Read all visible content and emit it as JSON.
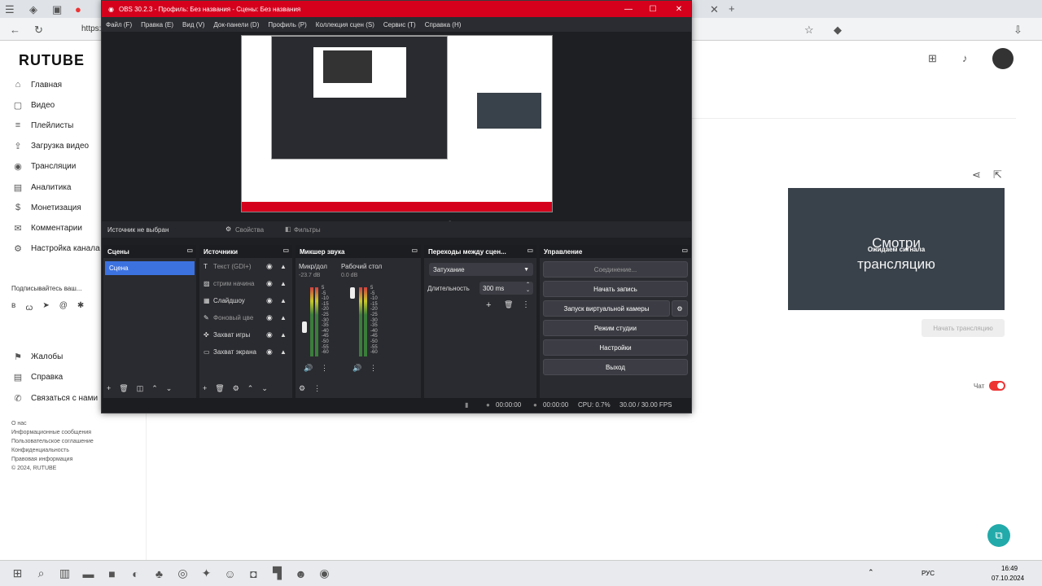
{
  "browser": {
    "tab_url": "https://",
    "icons": [
      "menu-icon",
      "shield-icon",
      "tabs-icon",
      "yandex-icon",
      "back-icon",
      "reload-icon",
      "new-tab-icon",
      "close-tab-icon",
      "star-icon",
      "extensions-icon",
      "profile-icon",
      "downloads-icon"
    ]
  },
  "site": {
    "logo": "RUTUBE",
    "nav": [
      {
        "label": "Главная",
        "icon": "home-icon"
      },
      {
        "label": "Видео",
        "icon": "video-icon"
      },
      {
        "label": "Плейлисты",
        "icon": "playlist-icon"
      },
      {
        "label": "Загрузка видео",
        "icon": "upload-icon"
      },
      {
        "label": "Трансляции",
        "icon": "broadcast-icon"
      },
      {
        "label": "Аналитика",
        "icon": "analytics-icon"
      },
      {
        "label": "Монетизация",
        "icon": "money-icon"
      },
      {
        "label": "Комментарии",
        "icon": "comments-icon"
      },
      {
        "label": "Настройка канала",
        "icon": "settings-icon"
      }
    ],
    "notice": "Подписывайтесь ваш...",
    "nav2": [
      {
        "label": "Жалобы",
        "icon": "flag-icon"
      },
      {
        "label": "Справка",
        "icon": "help-icon"
      },
      {
        "label": "Связаться с нами",
        "icon": "mail-icon"
      }
    ],
    "footer": [
      "О нас",
      "Информационные сообщения",
      "Пользовательское соглашение",
      "Конфиденциальность",
      "Правовая информация",
      "© 2024, RUTUBE"
    ],
    "stream_thumb_big": "Смотри трансляцию",
    "stream_thumb_badge": "Ожидаем сигнала",
    "start_stream_button": "Начать трансляцию",
    "chat_label": "Чат"
  },
  "obs": {
    "title": "OBS 30.2.3 - Профиль: Без названия - Сцены: Без названия",
    "menu": [
      "Файл (F)",
      "Правка (E)",
      "Вид (V)",
      "Док-панели (D)",
      "Профиль (P)",
      "Коллекция сцен (S)",
      "Сервис (T)",
      "Справка (H)"
    ],
    "no_source": "Источник не выбран",
    "properties": "Свойства",
    "filters": "Фильтры",
    "scenes_title": "Сцены",
    "scenes": [
      "Сцена"
    ],
    "sources_title": "Источники",
    "sources": [
      {
        "label": "Текст (GDI+)",
        "icon": "text-icon"
      },
      {
        "label": "стрим начина",
        "icon": "image-icon"
      },
      {
        "label": "Слайдшоу",
        "icon": "slideshow-icon"
      },
      {
        "label": "Фоновый цве",
        "icon": "brush-icon"
      },
      {
        "label": "Захват игры",
        "icon": "gamepad-icon"
      },
      {
        "label": "Захват экрана",
        "icon": "monitor-icon"
      }
    ],
    "mixer_title": "Микшер звука",
    "mixer": [
      {
        "name": "Микр/дол",
        "db": "-23.7 dB"
      },
      {
        "name": "Рабочий стол",
        "db": "0.0 dB"
      }
    ],
    "meter_scale": [
      "5",
      "-5",
      "-10",
      "-15",
      "-20",
      "-25",
      "-30",
      "-35",
      "-40",
      "-45",
      "-50",
      "-55",
      "-60"
    ],
    "transitions_title": "Переходы между сцен...",
    "transition": "Затухание",
    "duration_label": "Длительность",
    "duration_value": "300 ms",
    "controls_title": "Управление",
    "controls": [
      "Соединение...",
      "Начать запись",
      "Запуск виртуальной камеры",
      "Режим студии",
      "Настройки",
      "Выход"
    ],
    "status": {
      "rec_time": "00:00:00",
      "stream_time": "00:00:00",
      "cpu": "CPU: 0.7%",
      "fps": "30.00 / 30.00 FPS"
    }
  },
  "taskbar": {
    "icons": [
      "windows-icon",
      "search-icon",
      "taskview-icon",
      "explorer-icon",
      "minecraft-icon",
      "edge-icon",
      "terraria-icon",
      "obs-icon",
      "game-icon",
      "discord-icon",
      "instagram-icon",
      "twitch-icon",
      "discord2-icon",
      "yandex-icon"
    ],
    "lang": "РУС",
    "time": "16:49",
    "date": "07.10.2024"
  },
  "colors": {
    "obs_title": "#d4001c",
    "accent_blue": "#3c72e0",
    "obs_bg": "#1e1f23"
  }
}
